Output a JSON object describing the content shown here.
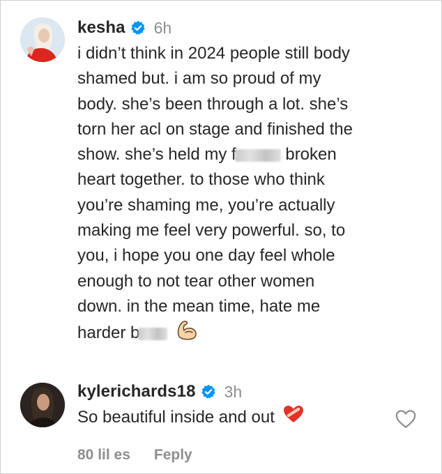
{
  "comments": [
    {
      "username": "kesha",
      "time": "6h",
      "avatar_icon": "profile-photo-kesha",
      "lines": [
        "i didn’t think in 2024 people still body",
        "shamed but. i am so proud of my",
        "body. she’s been through a lot. she’s",
        "torn her acl on stage and finished the",
        "show. she’s held my f",
        "broken",
        "heart together. to those who think",
        "you’re shaming me, you’re actually",
        "making me feel very powerful. so, to",
        "you, i hope you one day feel whole",
        "enough to not tear other women",
        "down. in the mean time, hate me",
        "harder b"
      ],
      "emoji_icon": "flexed-biceps-emoji"
    },
    {
      "username": "kylerichards18",
      "time": "3h",
      "avatar_icon": "profile-photo-kylerichards18",
      "text": "So beautiful inside and out",
      "emoji_icon": "heart-with-bandage-emoji",
      "likes": "80 lil es",
      "reply": "Feply"
    }
  ],
  "colors": {
    "verified": "#0095f6",
    "secondary_text": "#8e8e8e",
    "primary_text": "#262626",
    "heart_emoji": "#e0342a"
  }
}
